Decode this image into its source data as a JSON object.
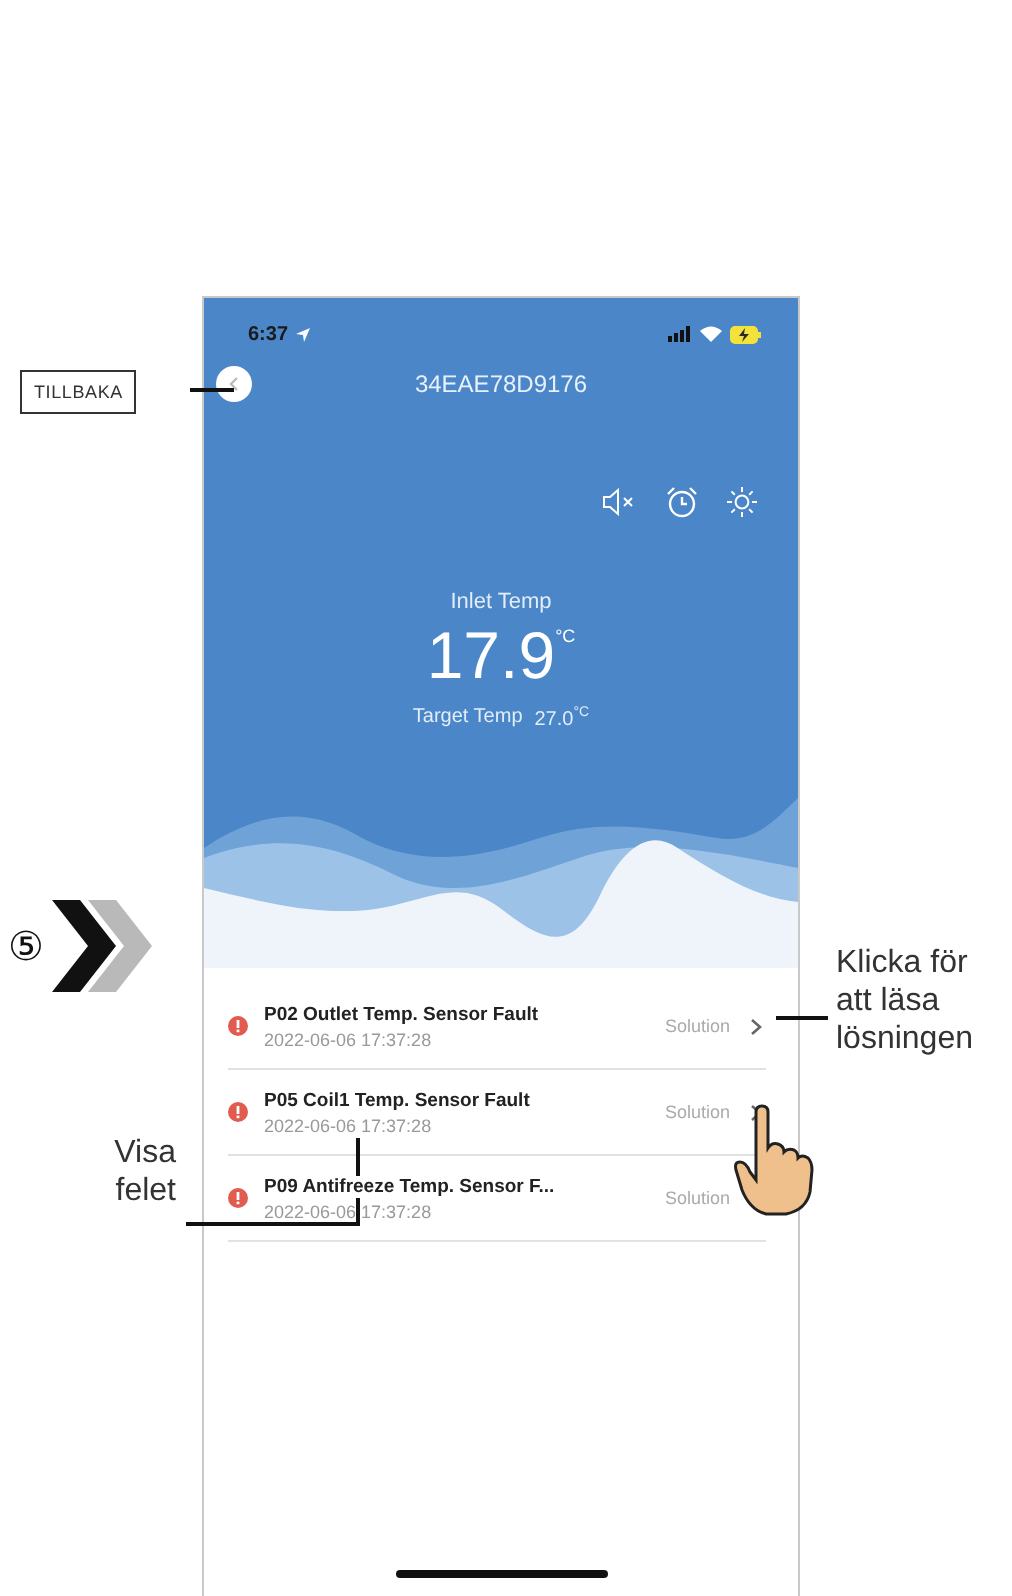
{
  "status_bar": {
    "time": "6:37"
  },
  "header": {
    "title": "34EAE78D9176"
  },
  "reading": {
    "label": "Inlet Temp",
    "value": "17.9",
    "unit": "°C",
    "target_label": "Target Temp",
    "target_value": "27.0",
    "target_unit": "°C"
  },
  "faults": [
    {
      "title": "P02 Outlet Temp. Sensor Fault",
      "time": "2022-06-06 17:37:28",
      "action": "Solution",
      "chevron": true
    },
    {
      "title": "P05 Coil1 Temp. Sensor Fault",
      "time": "2022-06-06 17:37:28",
      "action": "Solution",
      "chevron": true
    },
    {
      "title": "P09 Antifreeze Temp. Sensor F...",
      "time": "2022-06-06 17:37:28",
      "action": "Solution",
      "chevron": false
    }
  ],
  "annotations": {
    "back": "TILLBAKA",
    "step": "⑤",
    "solution_note": "Klicka för att läsa lösningen",
    "fault_note": "Visa felet"
  }
}
